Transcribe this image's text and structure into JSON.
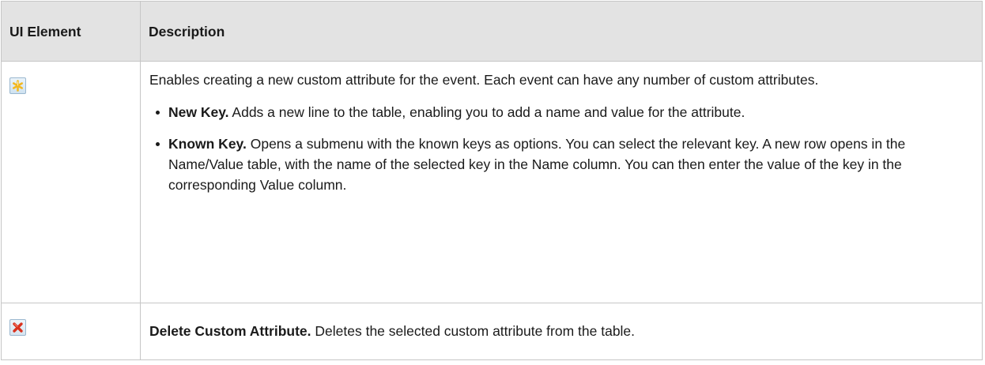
{
  "header": {
    "col1": "UI Element",
    "col2": "Description"
  },
  "rows": [
    {
      "icon": "new-custom-attribute-icon",
      "lead": "Enables creating a new custom attribute for the event. Each event can have any number of custom attributes.",
      "options": [
        {
          "term": "New Key.",
          "text": " Adds a new line to the table, enabling you to add a name and value for the attribute."
        },
        {
          "term": "Known Key.",
          "text": " Opens a submenu with the known keys as options. You can select the relevant key. A new row opens in the Name/Value table, with the name of the selected key in the Name column. You can then enter the value of the key in the corresponding Value column."
        }
      ]
    },
    {
      "icon": "delete-icon",
      "term": "Delete Custom Attribute.",
      "text": " Deletes the selected custom attribute from the table."
    }
  ],
  "colors": {
    "header_bg": "#e3e3e3",
    "border": "#c6c6c6",
    "delete_red": "#d9321e",
    "new_star": "#f2b822"
  }
}
